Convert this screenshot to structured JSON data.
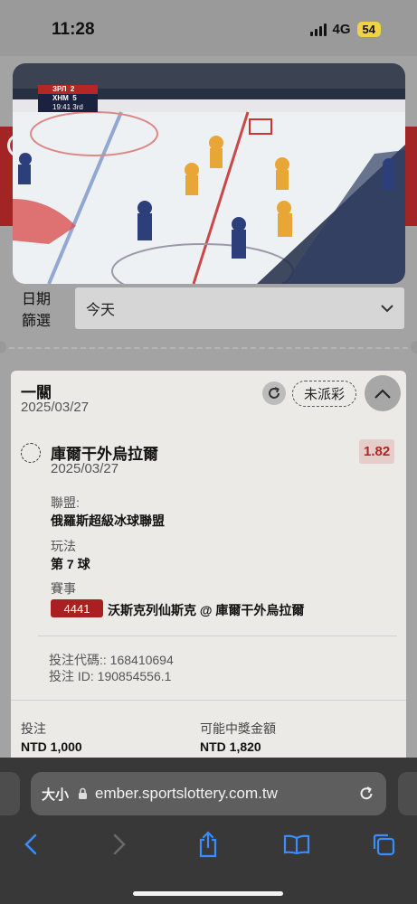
{
  "status_bar": {
    "time": "11:28",
    "network": "4G",
    "battery": "54"
  },
  "video": {
    "score_team1": "ЗРЛ",
    "score1": "2",
    "score_team2": "ХНМ",
    "score2": "5",
    "clock": "19:41",
    "period": "3rd"
  },
  "filter": {
    "label_line1": "日期",
    "label_line2": "篩選",
    "value": "今天"
  },
  "bet_card": {
    "title": "一關",
    "date": "2025/03/27",
    "status": "未派彩",
    "selection": "庫爾干外烏拉爾",
    "selection_date": "2025/03/27",
    "odds": "1.82",
    "league_label": "聯盟:",
    "league_value": "俄羅斯超級冰球聯盟",
    "market_label": "玩法",
    "market_value": "第 7 球",
    "event_label": "賽事",
    "event_id": "4441",
    "event_name": "沃斯克列仙斯克 @ 庫爾干外烏拉爾",
    "bet_code": "投注代碼:: 168410694",
    "bet_id": "投注 ID: 190854556.1",
    "stake_label": "投注",
    "stake_value": "NTD 1,000",
    "payout_label": "可能中獎金額",
    "payout_value": "NTD 1,820"
  },
  "browser": {
    "aa_label": "大小",
    "url": "ember.sportslottery.com.tw"
  },
  "colors": {
    "accent_red": "#aa1f1f",
    "odds_red": "#b02525",
    "card_bg": "#ebeae6"
  }
}
